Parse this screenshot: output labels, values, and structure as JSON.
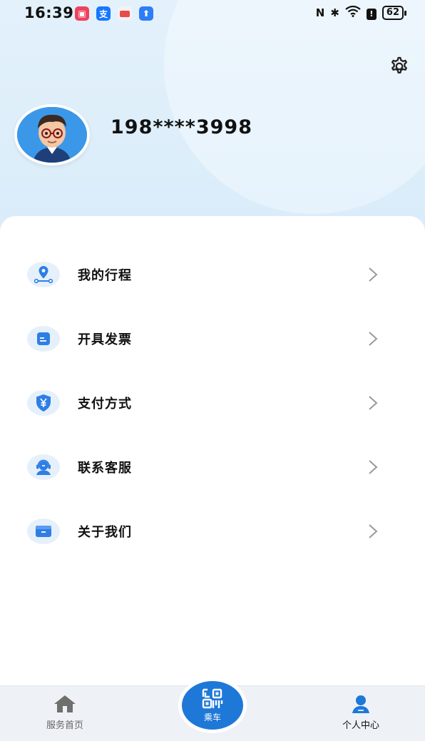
{
  "status_bar": {
    "time": "16:39",
    "battery": "62"
  },
  "profile": {
    "phone": "198****3998"
  },
  "menu": [
    {
      "label": "我的行程",
      "icon": "location-route-icon"
    },
    {
      "label": "开具发票",
      "icon": "invoice-icon"
    },
    {
      "label": "支付方式",
      "icon": "yuan-shield-icon"
    },
    {
      "label": "联系客服",
      "icon": "customer-service-icon"
    },
    {
      "label": "关于我们",
      "icon": "about-box-icon"
    }
  ],
  "bottom_nav": {
    "home_label": "服务首页",
    "ride_label": "乘车",
    "me_label": "个人中心"
  },
  "colors": {
    "accent": "#1e78d8",
    "icon_blue": "#2e7ee6",
    "icon_bg": "#e6f0fb",
    "header_bg": "#e3f1fb"
  }
}
